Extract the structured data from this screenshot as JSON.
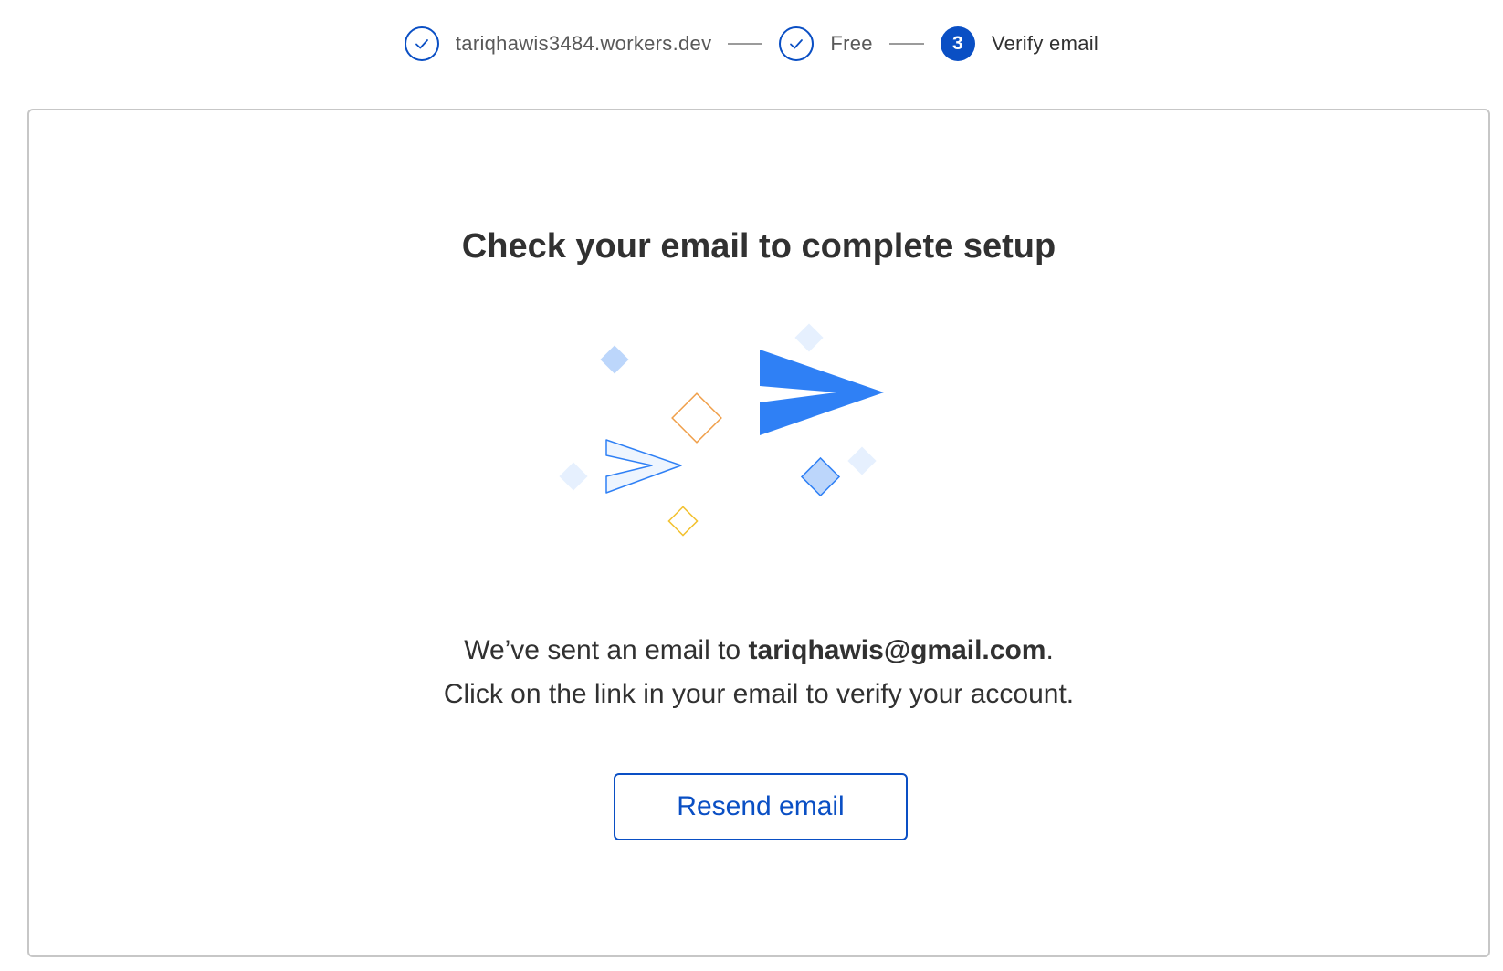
{
  "stepper": {
    "steps": [
      {
        "label": "tariqhawis3484.workers.dev",
        "status": "complete",
        "icon": "check-icon"
      },
      {
        "label": "Free",
        "status": "complete",
        "icon": "check-icon"
      },
      {
        "label": "Verify email",
        "status": "current",
        "number": "3"
      }
    ]
  },
  "main": {
    "title": "Check your email to complete setup",
    "message_prefix": "We’ve sent an email to ",
    "email": "tariqhawis@gmail.com",
    "message_suffix": ".",
    "message_line2": "Click on the link in your email to verify your account.",
    "resend_label": "Resend email"
  },
  "illustration": {
    "icon": "paper-plane-icon"
  },
  "colors": {
    "accent": "#0a4fc4",
    "plane": "#2f80f5",
    "diamond_light": "#bcd6fb",
    "diamond_faint": "#e6f0fe",
    "diamond_orange": "#f0a04b",
    "diamond_yellow": "#f2c12e"
  }
}
